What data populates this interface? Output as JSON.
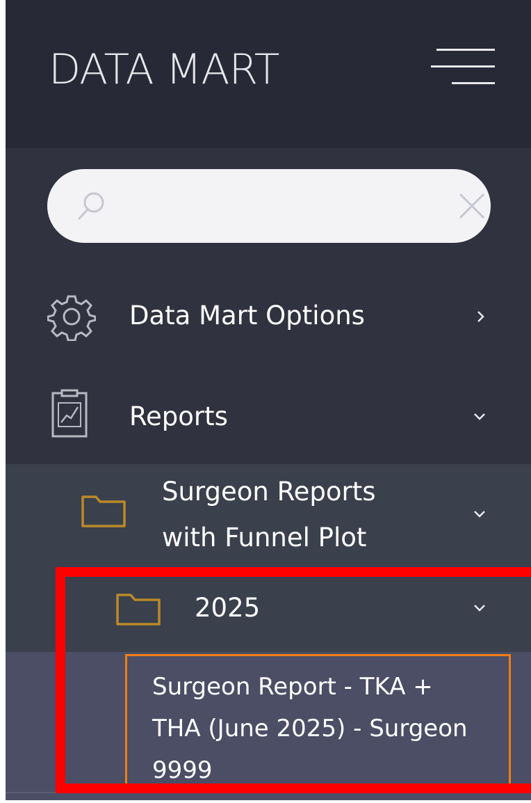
{
  "header": {
    "title": "DATA MART",
    "menu_icon": "hamburger-menu-icon"
  },
  "search": {
    "value": "",
    "placeholder": "",
    "search_icon": "search-icon",
    "clear_icon": "close-icon"
  },
  "nav": {
    "data_mart_options": {
      "label": "Data Mart Options",
      "icon": "gear-icon",
      "chevron": "chevron-right-icon"
    },
    "reports": {
      "label": "Reports",
      "icon": "clipboard-chart-icon",
      "chevron": "chevron-down-icon"
    },
    "surgeon_reports_folder": {
      "label_line1": "Surgeon Reports",
      "label_line2": "with Funnel Plot",
      "icon": "folder-icon",
      "chevron": "chevron-down-icon"
    },
    "year_folder": {
      "label": "2025",
      "icon": "folder-icon",
      "chevron": "chevron-down-icon"
    },
    "report_item": {
      "line1": "Surgeon Report - TKA +",
      "line2": "THA (June 2025) - Surgeon",
      "line3": "9999"
    }
  },
  "colors": {
    "header_bg": "#282937",
    "sidebar_bg": "#31323f",
    "submenu_bg": "#3a404c",
    "selected_bg": "#4b4e65",
    "folder": "#b98a2a",
    "highlight_red": "#ff0000",
    "selection_orange": "#f07d12"
  }
}
